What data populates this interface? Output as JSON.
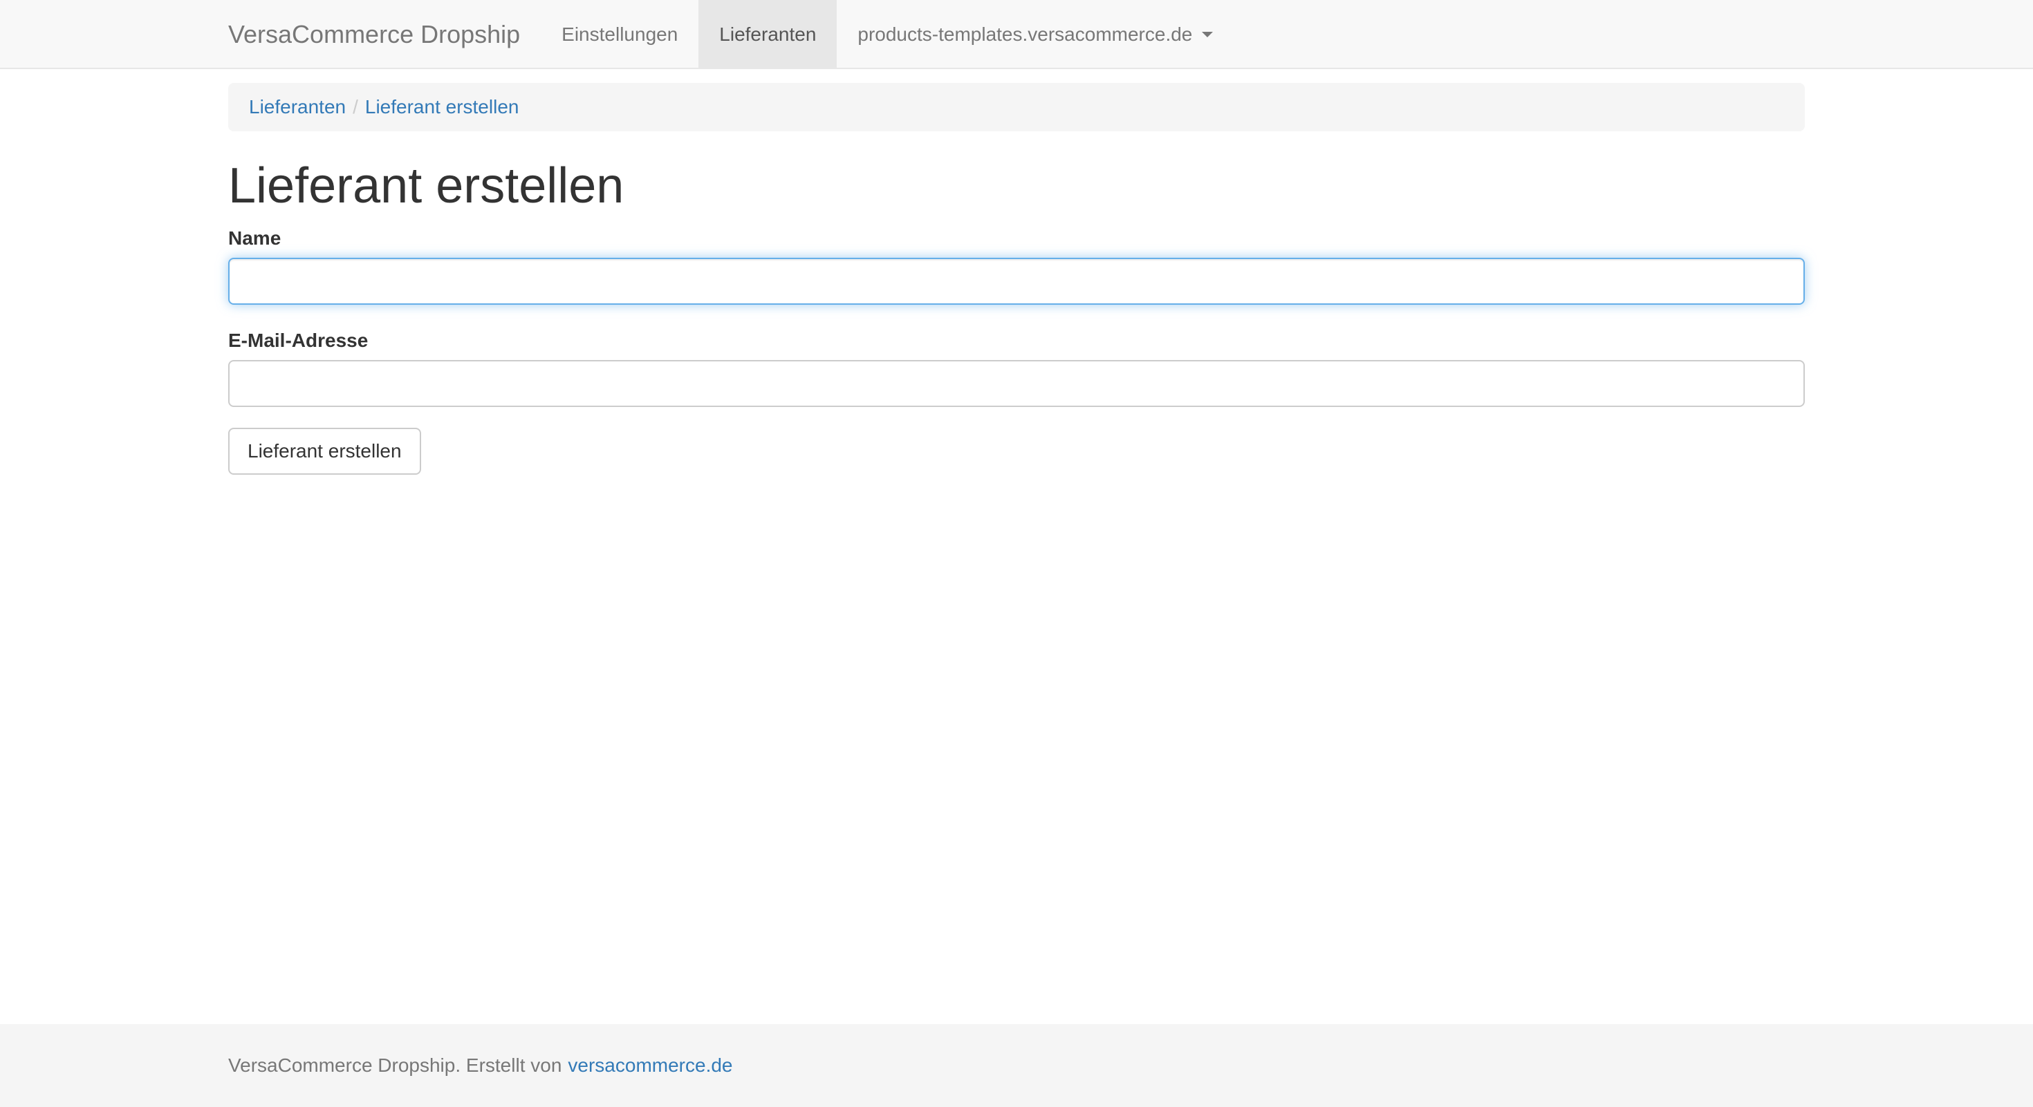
{
  "navbar": {
    "brand": "VersaCommerce Dropship",
    "items": [
      {
        "label": "Einstellungen",
        "active": false
      },
      {
        "label": "Lieferanten",
        "active": true
      }
    ],
    "shop_dropdown": {
      "label": "products-templates.versacommerce.de"
    }
  },
  "breadcrumb": {
    "items": [
      {
        "label": "Lieferanten"
      },
      {
        "label": "Lieferant erstellen"
      }
    ],
    "separator": "/"
  },
  "main": {
    "title": "Lieferant erstellen",
    "form": {
      "name_label": "Name",
      "name_value": "",
      "email_label": "E-Mail-Adresse",
      "email_value": "",
      "submit_label": "Lieferant erstellen"
    }
  },
  "footer": {
    "text": "VersaCommerce Dropship. Erstellt von",
    "link_label": "versacommerce.de"
  },
  "colors": {
    "link": "#337ab7",
    "navbar_bg": "#f8f8f8",
    "active_nav_bg": "#e7e7e7",
    "focus_border": "#66afe9",
    "footer_bg": "#f5f5f5"
  }
}
